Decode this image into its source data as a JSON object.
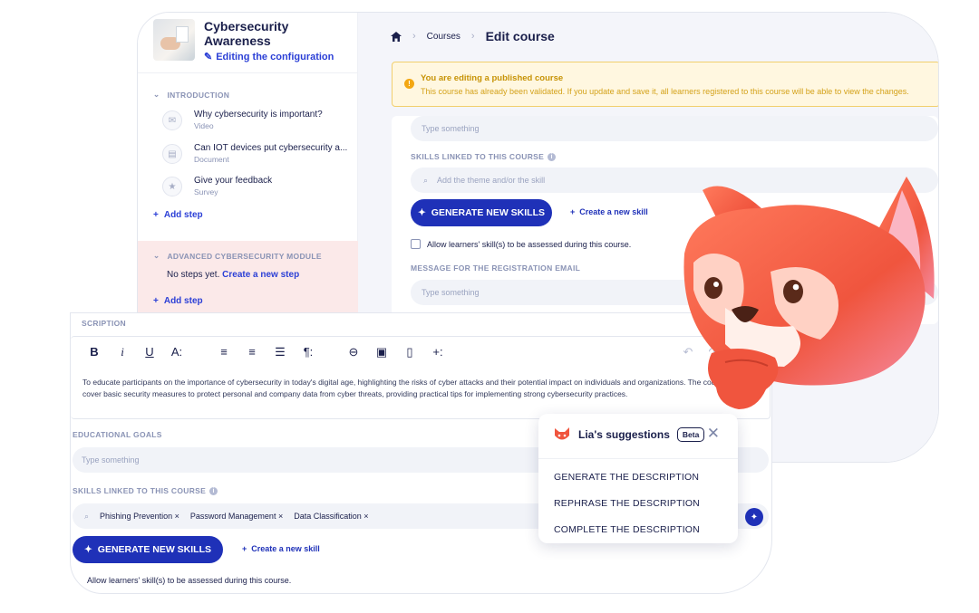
{
  "sidebar": {
    "course_title": "Cybersecurity Awareness",
    "editing_label": "Editing the configuration",
    "sections": [
      {
        "title": "INTRODUCTION",
        "steps": [
          {
            "title": "Why cybersecurity is important?",
            "type": "Video",
            "icon": "video-icon"
          },
          {
            "title": "Can IOT devices put cybersecurity a...",
            "type": "Document",
            "icon": "document-icon"
          },
          {
            "title": "Give your feedback",
            "type": "Survey",
            "icon": "star-icon"
          }
        ],
        "add_step": "Add step"
      },
      {
        "title": "ADVANCED CYBERSECURITY MODULE",
        "empty_text": "No steps yet.",
        "create_link": "Create a new step",
        "add_step": "Add step"
      }
    ]
  },
  "breadcrumb": {
    "items": [
      "Courses"
    ],
    "current": "Edit course"
  },
  "warning": {
    "title": "You are editing a published course",
    "text": "This course has already been validated. If you update and save it, all learners registered to this course will be able to view the changes."
  },
  "back_form": {
    "top_placeholder": "Type something",
    "skills_label": "SKILLS LINKED TO THIS COURSE",
    "skills_placeholder": "Add the theme and/or the skill",
    "generate_label": "GENERATE NEW SKILLS",
    "create_skill_label": "Create a new skill",
    "assess_label": "Allow learners' skill(s) to be assessed during this course.",
    "email_label": "MESSAGE FOR THE REGISTRATION EMAIL",
    "email_placeholder": "Type something"
  },
  "front_form": {
    "description_label": "DESCRIPTION",
    "description_label_visible": "SCRIPTION",
    "description_text": "To educate participants on the importance of cybersecurity in today's digital age, highlighting the risks of cyber attacks and their potential impact on individuals and organizations. The course will cover basic security measures to protect personal and company data from cyber threats, providing practical tips for implementing strong cybersecurity practices.",
    "goals_label": "EDUCATIONAL GOALS",
    "goals_placeholder": "Type something",
    "skills_label": "SKILLS LINKED TO THIS COURSE",
    "skill_tags": [
      "Phishing Prevention",
      "Password Management",
      "Data Classification"
    ],
    "generate_label": "GENERATE NEW SKILLS",
    "create_skill_label": "Create a new skill",
    "assess_label": "Allow learners' skill(s) to be assessed during this course."
  },
  "toolbar": {
    "bold": "B",
    "italic": "i",
    "underline": "U",
    "text_size": "A:",
    "align_left": "≡",
    "align_center": "≡",
    "list": "☰",
    "paragraph": "¶:",
    "link": "⊖",
    "image": "▣",
    "file": "▯",
    "insert": "+:",
    "undo": "↶",
    "redo": "↷"
  },
  "suggestions": {
    "title": "Lia's suggestions",
    "badge": "Beta",
    "items": [
      "GENERATE THE DESCRIPTION",
      "REPHRASE THE DESCRIPTION",
      "COMPLETE THE DESCRIPTION"
    ]
  },
  "colors": {
    "primary": "#1f31b8",
    "link": "#2b3fd6",
    "warning_bg": "#fff7e0",
    "warning_text": "#c79306",
    "module_bg": "#fbe9e9",
    "mascot": "#f0553e"
  }
}
